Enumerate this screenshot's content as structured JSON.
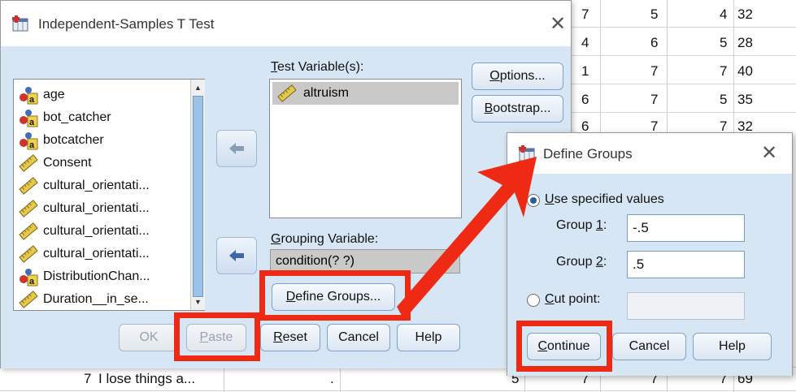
{
  "spreadsheet": {
    "rows": [
      {
        "c1": "7",
        "c2": "5",
        "c3": "4",
        "c4": "32"
      },
      {
        "c1": "4",
        "c2": "6",
        "c3": "5",
        "c4": "28"
      },
      {
        "c1": "1",
        "c2": "7",
        "c3": "7",
        "c4": "40"
      },
      {
        "c1": "6",
        "c2": "7",
        "c3": "5",
        "c4": "35"
      },
      {
        "c1": "6",
        "c2": "7",
        "c3": "7",
        "c4": "32"
      }
    ],
    "bottom_row": {
      "num": "7",
      "text": "I lose things a...",
      "dot": ".",
      "v5": "5",
      "v7a": "7",
      "v7b": "7",
      "v7c": "7",
      "v69": "69"
    }
  },
  "main_dialog": {
    "title": "Independent-Samples T Test",
    "variables": [
      {
        "label": "age",
        "icon": "nominal-icon"
      },
      {
        "label": "bot_catcher",
        "icon": "nominal-icon"
      },
      {
        "label": "botcatcher",
        "icon": "nominal-icon"
      },
      {
        "label": "Consent",
        "icon": "scale-icon"
      },
      {
        "label": "cultural_orientati...",
        "icon": "scale-icon"
      },
      {
        "label": "cultural_orientati...",
        "icon": "scale-icon"
      },
      {
        "label": "cultural_orientati...",
        "icon": "scale-icon"
      },
      {
        "label": "cultural_orientati...",
        "icon": "scale-icon"
      },
      {
        "label": "DistributionChan...",
        "icon": "nominal-icon"
      },
      {
        "label": "Duration__in_se...",
        "icon": "scale-icon"
      }
    ],
    "test_variables_label_u": "T",
    "test_variables_label_rest": "est Variable(s):",
    "test_variables": [
      "altruism"
    ],
    "grouping_label_u": "G",
    "grouping_label_rest": "rouping Variable:",
    "grouping_value": "condition(? ?)",
    "define_groups_u": "D",
    "define_groups_rest": "efine Groups...",
    "options_u": "O",
    "options_rest": "ptions...",
    "bootstrap_u": "B",
    "bootstrap_rest": "ootstrap...",
    "ok": "OK",
    "paste_u": "P",
    "paste_rest": "aste",
    "reset_u": "R",
    "reset_rest": "eset",
    "cancel": "Cancel",
    "help": "Help"
  },
  "define_groups_dialog": {
    "title": "Define Groups",
    "use_specified_u": "U",
    "use_specified_rest": "se specified values",
    "group1_pre": "Group ",
    "group1_u": "1",
    "group1_post": ":",
    "group1_value": "-.5",
    "group2_pre": "Group ",
    "group2_u": "2",
    "group2_post": ":",
    "group2_value": ".5",
    "cut_point_u": "C",
    "cut_point_rest": "ut point:",
    "cut_point_value": "",
    "continue_u": "C",
    "continue_rest": "ontinue",
    "cancel": "Cancel",
    "help": "Help"
  },
  "colors": {
    "highlight": "#ee2a14",
    "dialog_bg": "#d7e6f5",
    "accent": "#2a5d9f"
  }
}
